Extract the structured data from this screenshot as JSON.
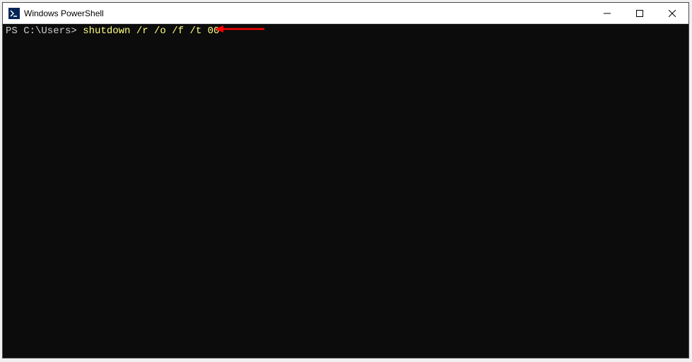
{
  "window": {
    "title": "Windows PowerShell"
  },
  "terminal": {
    "prompt": "PS C:\\Users> ",
    "command": "shutdown /r /o /f /t 00"
  },
  "annotation": {
    "arrow_color": "#ff0000"
  }
}
